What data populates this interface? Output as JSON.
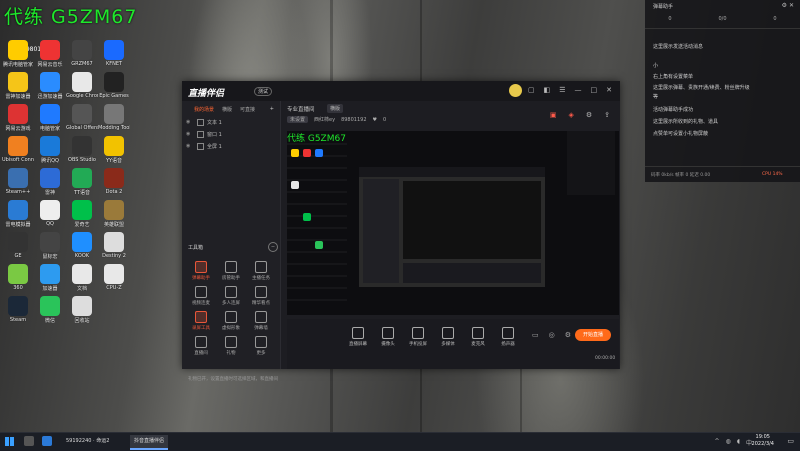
{
  "desktop": {
    "overlay_title": "代练 G5ZM67",
    "id_text": "59801",
    "icons": [
      {
        "label": "腾讯电脑管家",
        "color": "#ffcc00"
      },
      {
        "label": "网易云音乐",
        "color": "#e33"
      },
      {
        "label": "GRZM67",
        "color": "#444"
      },
      {
        "label": "KFNET",
        "color": "#1a6aff"
      },
      {
        "label": "雷神加速器",
        "color": "#f5c518"
      },
      {
        "label": "迅游加速器",
        "color": "#2a8cff"
      },
      {
        "label": "Google Chrome",
        "color": "#e8e8e8"
      },
      {
        "label": "Epic Games",
        "color": "#222"
      },
      {
        "label": "网易云游戏",
        "color": "#d33"
      },
      {
        "label": "电脑管家",
        "color": "#1f7aff"
      },
      {
        "label": "Global Offensive",
        "color": "#555"
      },
      {
        "label": "Modding Tools",
        "color": "#777"
      },
      {
        "label": "Ubisoft Connect",
        "color": "#f08020"
      },
      {
        "label": "腾讯QQ",
        "color": "#1a7ad9"
      },
      {
        "label": "OBS Studio",
        "color": "#333"
      },
      {
        "label": "YY语音",
        "color": "#f2c200"
      },
      {
        "label": "Steam++",
        "color": "#3a6fb0"
      },
      {
        "label": "雷神",
        "color": "#2d6bd6"
      },
      {
        "label": "TT语音",
        "color": "#22aa55"
      },
      {
        "label": "Dota 2",
        "color": "#8a2a1a"
      },
      {
        "label": "雷电模拟器",
        "color": "#2a7bd4"
      },
      {
        "label": "QQ",
        "color": "#eee"
      },
      {
        "label": "爱奇艺",
        "color": "#00c04a"
      },
      {
        "label": "英雄联盟",
        "color": "#9a7a3a"
      },
      {
        "label": "GE",
        "color": "#333"
      },
      {
        "label": "鼠标宏",
        "color": "#444"
      },
      {
        "label": "KOOK",
        "color": "#1f8fff"
      },
      {
        "label": "Destiny 2",
        "color": "#ddd"
      },
      {
        "label": "360",
        "color": "#7ac943"
      },
      {
        "label": "加速器",
        "color": "#2d9bf0"
      },
      {
        "label": "文档",
        "color": "#e8e8e8"
      },
      {
        "label": "CPU-Z",
        "color": "#e8e8e8"
      },
      {
        "label": "Steam",
        "color": "#1b2838"
      },
      {
        "label": "微信",
        "color": "#2ac45a"
      },
      {
        "label": "回收站",
        "color": "#ddd"
      },
      {
        "label": "",
        "color": "transparent"
      }
    ]
  },
  "app": {
    "logo": "直播伴侣",
    "badge": "测试",
    "left_tabs": [
      "我的场景",
      "横版",
      "可直接"
    ],
    "scenes": [
      "文本 1",
      "窗口 1",
      "全屏 1"
    ],
    "tools_title": "工具箱",
    "tools": [
      {
        "label": "弹幕助手",
        "active": true
      },
      {
        "label": "房管助手",
        "active": false
      },
      {
        "label": "主播任务",
        "active": false
      },
      {
        "label": "视频连麦",
        "active": false
      },
      {
        "label": "多人连屏",
        "active": false
      },
      {
        "label": "精华看点",
        "active": false
      },
      {
        "label": "录屏工具",
        "active": true
      },
      {
        "label": "虚拟形象",
        "active": false
      },
      {
        "label": "弹幕墙",
        "active": false
      },
      {
        "label": "直播间",
        "active": false
      },
      {
        "label": "礼物",
        "active": false
      },
      {
        "label": "更多",
        "active": false
      }
    ],
    "hint": "礼物已开，设置直播时可选择区域，和直播间",
    "stream_title": "专业直播间",
    "stream_tag": "横版",
    "status_chip": "未设置",
    "room_name": "西红柿ey",
    "room_id": "89801192",
    "likes": "0",
    "bottom_items": [
      "直播屏幕",
      "摄像头",
      "手机投屏",
      "多媒体",
      "麦克风",
      "扬声器"
    ],
    "start_label": "开始直播",
    "timer": "00:00:00"
  },
  "chat": {
    "title": "弹幕助手",
    "stats": [
      "0",
      "0/0",
      "0"
    ],
    "lines": [
      "这里展示发送活动消息",
      "小",
      "右上角有设置菜单",
      "这里展示弹幕、贵族开通/续费、粉丝牌升级",
      "等",
      "活动弹幕助手成功",
      "这里展示所收到的礼物、道具",
      "点赞单可设置小礼物屏蔽"
    ],
    "footer": "码率 0kb/s 帧率 0 延迟 0.00",
    "cpu": "CPU 14%"
  },
  "taskbar": {
    "tasks": [
      {
        "label": "59192240 · 命运2",
        "active": false
      },
      {
        "label": "抖音直播伴侣",
        "active": true
      }
    ],
    "time": "19:05",
    "date": "2022/3/4"
  }
}
